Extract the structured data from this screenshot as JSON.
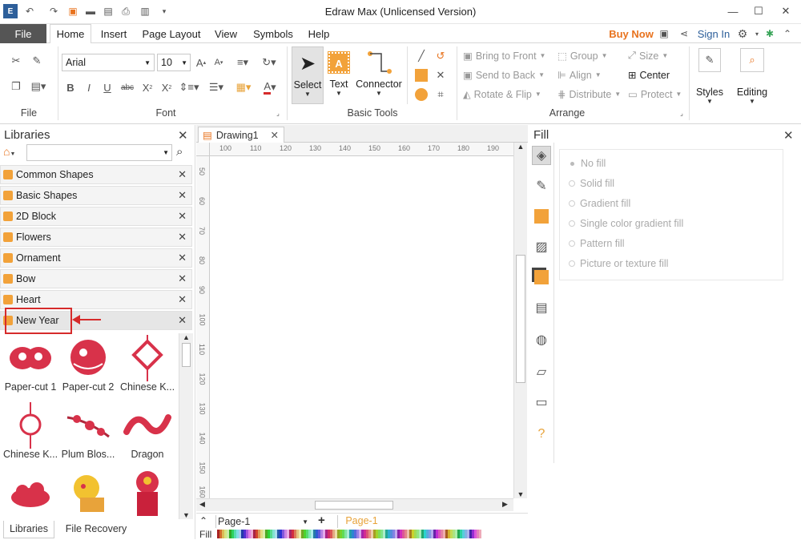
{
  "app": {
    "title": "Edraw Max (Unlicensed Version)"
  },
  "ribbon_tabs": [
    "File",
    "Home",
    "Insert",
    "Page Layout",
    "View",
    "Symbols",
    "Help"
  ],
  "account": {
    "buy_now": "Buy Now",
    "sign_in": "Sign In"
  },
  "font": {
    "family": "Arial",
    "size": "10"
  },
  "groups": {
    "file": "File",
    "font": "Font",
    "basic_tools": "Basic Tools",
    "arrange": "Arrange"
  },
  "basic_tools": {
    "select": "Select",
    "text": "Text",
    "connector": "Connector"
  },
  "arrange": {
    "bring_to_front": "Bring to Front",
    "send_to_back": "Send to Back",
    "rotate_flip": "Rotate & Flip",
    "group": "Group",
    "align": "Align",
    "distribute": "Distribute",
    "size": "Size",
    "center": "Center",
    "protect": "Protect"
  },
  "styles_label": "Styles",
  "editing_label": "Editing",
  "libraries": {
    "title": "Libraries",
    "search_value": "",
    "items": [
      "Common Shapes",
      "Basic Shapes",
      "2D Block",
      "Flowers",
      "Ornament",
      "Bow",
      "Heart",
      "New Year"
    ],
    "thumbs": [
      "Paper-cut 1",
      "Paper-cut 2",
      "Chinese K...",
      "Chinese K...",
      "Plum Blos...",
      "Dragon"
    ],
    "bottom_tabs": [
      "Libraries",
      "File Recovery"
    ]
  },
  "document": {
    "tab": "Drawing1",
    "ruler_h": [
      "100",
      "110",
      "120",
      "130",
      "140",
      "150",
      "160",
      "170",
      "180",
      "190"
    ],
    "ruler_v": [
      "50",
      "60",
      "70",
      "80",
      "90",
      "100",
      "110",
      "120",
      "130",
      "140",
      "150",
      "160"
    ],
    "page_select": "Page-1",
    "page_tab": "Page-1",
    "fill_label": "Fill"
  },
  "fill_panel": {
    "title": "Fill",
    "options": [
      "No fill",
      "Solid fill",
      "Gradient fill",
      "Single color gradient fill",
      "Pattern fill",
      "Picture or texture fill"
    ]
  },
  "colors": {
    "accent": "#e8731e",
    "highlight": "#d62b2b",
    "shape_red": "#d8324a"
  }
}
